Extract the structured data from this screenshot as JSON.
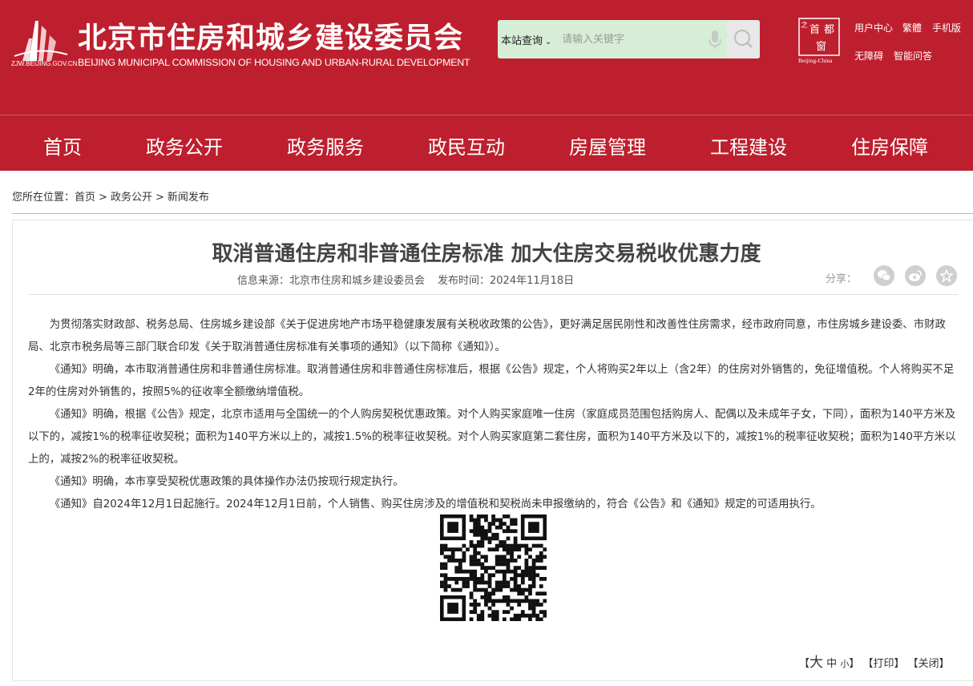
{
  "header": {
    "logo_domain": "ZJW.BEIJING.GOV.CN",
    "title": "北京市住房和城乡建设委员会",
    "subtitle": "BEIJING MUNICIPAL COMMISSION OF HOUSING AND URBAN-RURAL DEVELOPMENT",
    "badge_chars": [
      "首",
      "都",
      "之",
      "窗"
    ],
    "badge_caption": "Beijing-China",
    "search": {
      "scope": "本站查询",
      "placeholder": "请输入关键字"
    },
    "links": [
      "用户中心",
      "繁體",
      "手机版",
      "无障碍",
      "智能问答"
    ]
  },
  "nav": [
    "首页",
    "政务公开",
    "政务服务",
    "政民互动",
    "房屋管理",
    "工程建设",
    "住房保障"
  ],
  "breadcrumb": {
    "prefix": "您所在位置：",
    "items": [
      "首页",
      "政务公开",
      "新闻发布"
    ],
    "separator": ">"
  },
  "article": {
    "title": "取消普通住房和非普通住房标准 加大住房交易税收优惠力度",
    "source": "信息来源：北京市住房和城乡建设委员会",
    "date": "发布时间：2024年11月18日",
    "share_label": "分享：",
    "paragraphs": [
      "为贯彻落实财政部、税务总局、住房城乡建设部《关于促进房地产市场平稳健康发展有关税收政策的公告》，更好满足居民刚性和改善性住房需求，经市政府同意，市住房城乡建设委、市财政局、北京市税务局等三部门联合印发《关于取消普通住房标准有关事项的通知》（以下简称《通知》）。",
      "《通知》明确，本市取消普通住房和非普通住房标准。取消普通住房和非普通住房标准后，根据《公告》规定，个人将购买2年以上（含2年）的住房对外销售的，免征增值税。个人将购买不足2年的住房对外销售的，按照5%的征收率全额缴纳增值税。",
      "《通知》明确，根据《公告》规定，北京市适用与全国统一的个人购房契税优惠政策。对个人购买家庭唯一住房（家庭成员范围包括购房人、配偶以及未成年子女，下同），面积为140平方米及以下的，减按1%的税率征收契税；面积为140平方米以上的，减按1.5%的税率征收契税。对个人购买家庭第二套住房，面积为140平方米及以下的，减按1%的税率征收契税；面积为140平方米以上的，减按2%的税率征收契税。",
      "《通知》明确，本市享受契税优惠政策的具体操作办法仍按现行规定执行。",
      "《通知》自2024年12月1日起施行。2024年12月1日前，个人销售、购买住房涉及的增值税和契税尚未申报缴纳的，符合《公告》和《通知》规定的可适用执行。"
    ]
  },
  "tools": {
    "font_big": "大",
    "font_mid": "中",
    "font_small": "小",
    "print": "【打印】",
    "close": "【关闭】"
  },
  "colors": {
    "brand_red": "#be1f2e",
    "search_bg": "#d6eed6"
  }
}
